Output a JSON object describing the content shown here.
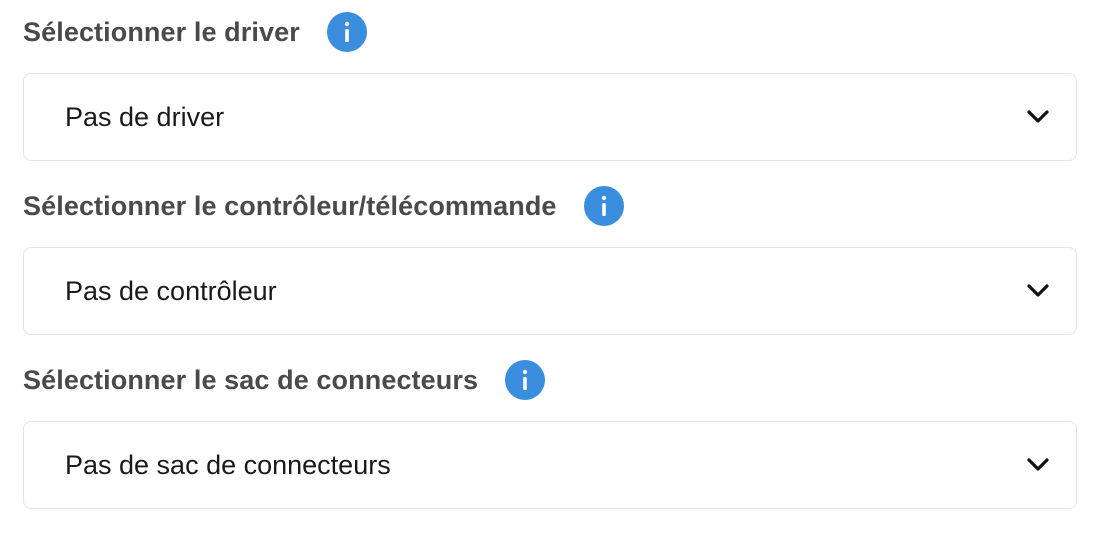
{
  "colors": {
    "info_icon": "#3b8ede",
    "label": "#4a4a4a",
    "value": "#1a1a1a",
    "border": "#e2e4e8"
  },
  "fields": [
    {
      "label": "Sélectionner le driver",
      "info_icon": "info-icon",
      "selected": "Pas de driver",
      "dropdown_icon": "chevron-down-icon"
    },
    {
      "label": "Sélectionner le contrôleur/télécommande",
      "info_icon": "info-icon",
      "selected": "Pas de contrôleur",
      "dropdown_icon": "chevron-down-icon"
    },
    {
      "label": "Sélectionner le sac de connecteurs",
      "info_icon": "info-icon",
      "selected": "Pas de sac de connecteurs",
      "dropdown_icon": "chevron-down-icon"
    }
  ]
}
